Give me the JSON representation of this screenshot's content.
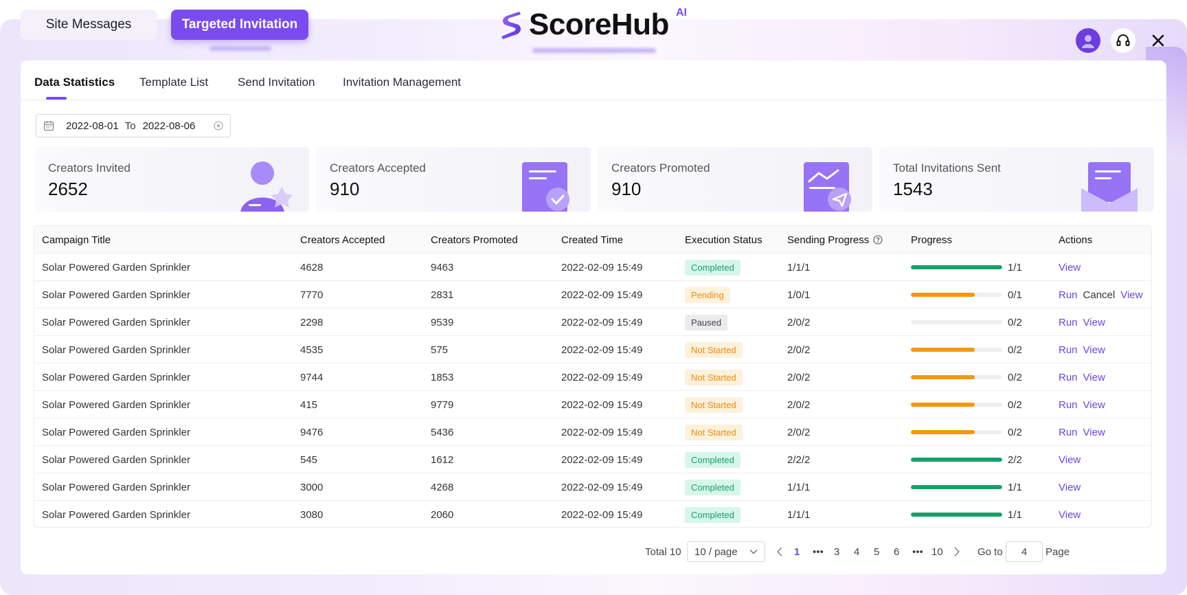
{
  "top_tabs": {
    "site_messages": "Site Messages",
    "targeted_invitation": "Targeted Invitation"
  },
  "brand": {
    "name": "ScoreHub",
    "suffix": "AI",
    "accent": "#7a4bf0"
  },
  "header_icons": [
    "avatar",
    "headset-icon",
    "close-icon"
  ],
  "subtabs": [
    "Data Statistics",
    "Template List",
    "Send Invitation",
    "Invitation Management"
  ],
  "date_range": {
    "start": "2022-08-01",
    "separator": "To",
    "end": "2022-08-06"
  },
  "stats": [
    {
      "label": "Creators Invited",
      "value": "2652",
      "icon": "user-icon"
    },
    {
      "label": "Creators Accepted",
      "value": "910",
      "icon": "document-check-icon"
    },
    {
      "label": "Creators Promoted",
      "value": "910",
      "icon": "chart-send-icon"
    },
    {
      "label": "Total Invitations Sent",
      "value": "1543",
      "icon": "envelope-icon"
    }
  ],
  "table": {
    "headers": [
      "Campaign Title",
      "Creators Accepted",
      "Creators Promoted",
      "Created Time",
      "Execution Status",
      "Sending Progress",
      "Progress",
      "Actions"
    ],
    "rows": [
      {
        "title": "Solar Powered Garden Sprinkler",
        "accepted": "4628",
        "promoted": "9463",
        "time": "2022-02-09  15:49",
        "status": "Completed",
        "sending": "1/1/1",
        "progress": 1.0,
        "progress_text": "1/1",
        "actions": [
          "View"
        ]
      },
      {
        "title": "Solar Powered Garden Sprinkler",
        "accepted": "7770",
        "promoted": "2831",
        "time": "2022-02-09  15:49",
        "status": "Pending",
        "sending": "1/0/1",
        "progress": 0.7,
        "progress_text": "0/1",
        "actions": [
          "Run",
          "Cancel",
          "View"
        ]
      },
      {
        "title": "Solar Powered Garden Sprinkler",
        "accepted": "2298",
        "promoted": "9539",
        "time": "2022-02-09  15:49",
        "status": "Paused",
        "sending": "2/0/2",
        "progress": 0.0,
        "progress_text": "0/2",
        "actions": [
          "Run",
          "View"
        ]
      },
      {
        "title": "Solar Powered Garden Sprinkler",
        "accepted": "4535",
        "promoted": "575",
        "time": "2022-02-09  15:49",
        "status": "Not Started",
        "sending": "2/0/2",
        "progress": 0.7,
        "progress_text": "0/2",
        "actions": [
          "Run",
          "View"
        ]
      },
      {
        "title": "Solar Powered Garden Sprinkler",
        "accepted": "9744",
        "promoted": "1853",
        "time": "2022-02-09  15:49",
        "status": "Not Started",
        "sending": "2/0/2",
        "progress": 0.7,
        "progress_text": "0/2",
        "actions": [
          "Run",
          "View"
        ]
      },
      {
        "title": "Solar Powered Garden Sprinkler",
        "accepted": "415",
        "promoted": "9779",
        "time": "2022-02-09  15:49",
        "status": "Not Started",
        "sending": "2/0/2",
        "progress": 0.7,
        "progress_text": "0/2",
        "actions": [
          "Run",
          "View"
        ]
      },
      {
        "title": "Solar Powered Garden Sprinkler",
        "accepted": "9476",
        "promoted": "5436",
        "time": "2022-02-09  15:49",
        "status": "Not Started",
        "sending": "2/0/2",
        "progress": 0.7,
        "progress_text": "0/2",
        "actions": [
          "Run",
          "View"
        ]
      },
      {
        "title": "Solar Powered Garden Sprinkler",
        "accepted": "545",
        "promoted": "1612",
        "time": "2022-02-09  15:49",
        "status": "Completed",
        "sending": "2/2/2",
        "progress": 1.0,
        "progress_text": "2/2",
        "actions": [
          "View"
        ]
      },
      {
        "title": "Solar Powered Garden Sprinkler",
        "accepted": "3000",
        "promoted": "4268",
        "time": "2022-02-09  15:49",
        "status": "Completed",
        "sending": "1/1/1",
        "progress": 1.0,
        "progress_text": "1/1",
        "actions": [
          "View"
        ]
      },
      {
        "title": "Solar Powered Garden Sprinkler",
        "accepted": "3080",
        "promoted": "2060",
        "time": "2022-02-09  15:49",
        "status": "Completed",
        "sending": "1/1/1",
        "progress": 1.0,
        "progress_text": "1/1",
        "actions": [
          "View"
        ]
      }
    ]
  },
  "pagination": {
    "total": "Total 10",
    "page_size": "10 / page",
    "pages": [
      "1",
      "•••",
      "3",
      "4",
      "5",
      "6",
      "•••",
      "10"
    ],
    "current": "1",
    "goto_label": "Go to",
    "goto_value": "4",
    "page_label": "Page"
  },
  "colors": {
    "completed": "#16a06a",
    "in_progress": "#f5980a",
    "link": "#6a45e0"
  }
}
